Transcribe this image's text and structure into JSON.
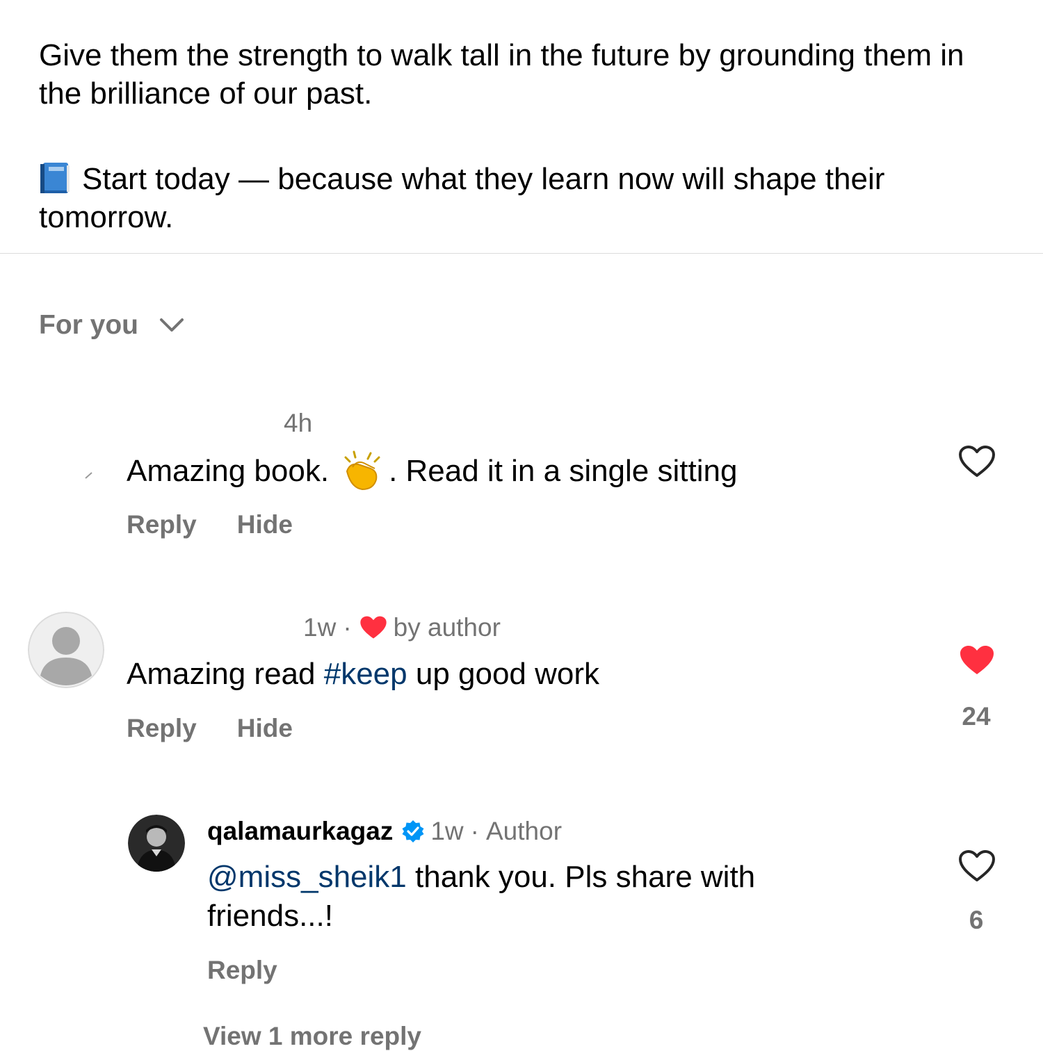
{
  "caption": {
    "line1": "Give them the strength to walk tall in the future by grounding them in the brilliance of our past.",
    "line2_icon": "blue-book-icon",
    "line2": "Start today — because what they learn now will shape their tomorrow."
  },
  "sort": {
    "label": "For you",
    "icon": "chevron-down-icon"
  },
  "comments": [
    {
      "time": "4h",
      "text_part1": "Amazing book.",
      "emoji": "clapping-hands-icon",
      "text_part2": ". Read it in a single sitting",
      "reply_label": "Reply",
      "hide_label": "Hide",
      "liked": false
    },
    {
      "time": "1w",
      "liked_by_author": "by author",
      "text_part1": "Amazing read",
      "hashtag": "#keep",
      "text_part2": "up good work",
      "reply_label": "Reply",
      "hide_label": "Hide",
      "liked": true,
      "like_count": "24"
    }
  ],
  "reply": {
    "username": "qalamaurkagaz",
    "verified": true,
    "time": "1w",
    "role": "Author",
    "mention": "@miss_sheik1",
    "text_line1": "thank you. Pls share with",
    "text_line2": "friends...!",
    "reply_label": "Reply",
    "liked": false,
    "like_count": "6"
  },
  "view_more": "View 1 more reply",
  "colors": {
    "secondary_text": "#737373",
    "link": "#00376b",
    "like_red": "#ff3040",
    "verified_blue": "#0095f6",
    "divider": "#dbdbdb"
  }
}
